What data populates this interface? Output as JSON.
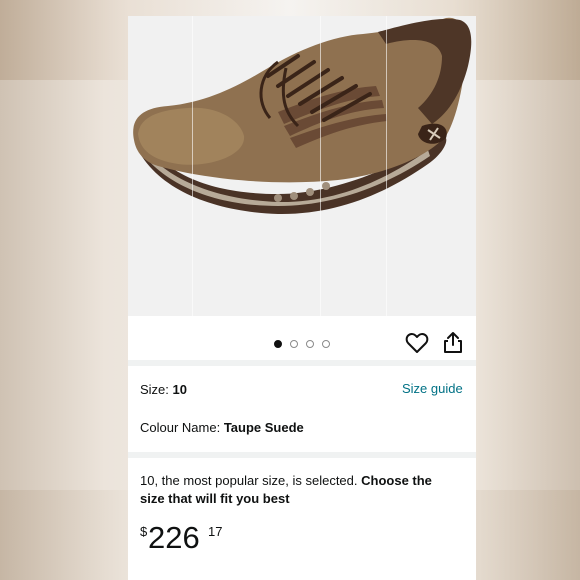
{
  "image": {
    "alt_object": "taupe suede lace-up sneaker",
    "carousel_dots": 4,
    "active_dot": 0
  },
  "actions": {
    "wishlist_icon": "heart-icon",
    "share_icon": "share-icon"
  },
  "size": {
    "label": "Size: ",
    "value": "10",
    "guide_link": "Size guide"
  },
  "colour": {
    "label": "Colour Name: ",
    "value": "Taupe Suede"
  },
  "message": {
    "text": "10, the most popular size, is selected. ",
    "emphasis": "Choose the size that will fit you best"
  },
  "price": {
    "currency": "$",
    "whole": "226",
    "fraction": "17"
  },
  "colors": {
    "link": "#007185",
    "text": "#0f1111",
    "separator": "#f0f2f2"
  }
}
